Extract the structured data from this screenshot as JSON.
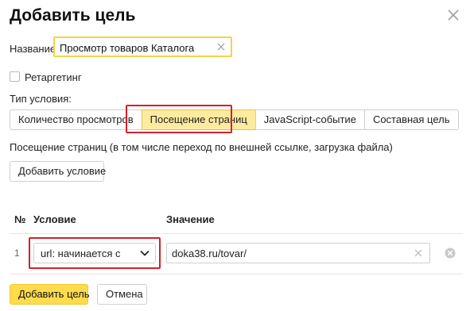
{
  "dialog": {
    "title": "Добавить цель",
    "close_icon": "close-icon"
  },
  "name_field": {
    "label": "Название",
    "value": "Просмотр товаров Каталога"
  },
  "retargeting": {
    "label": "Ретаргетинг",
    "checked": false
  },
  "condition_type": {
    "label": "Тип условия:",
    "tabs": [
      {
        "label": "Количество просмотров",
        "active": false
      },
      {
        "label": "Посещение страниц",
        "active": true
      },
      {
        "label": "JavaScript-событие",
        "active": false
      },
      {
        "label": "Составная цель",
        "active": false
      }
    ],
    "description": "Посещение страниц (в том числе переход по внешней ссылке, загрузка файла)"
  },
  "add_condition_label": "Добавить условие",
  "conditions_table": {
    "headers": {
      "num": "№",
      "condition": "Условие",
      "value": "Значение"
    },
    "rows": [
      {
        "num": "1",
        "condition": "url: начинается с",
        "value": "doka38.ru/tovar/"
      }
    ]
  },
  "footer": {
    "submit_label": "Добавить цель",
    "cancel_label": "Отмена"
  },
  "colors": {
    "accent_yellow": "#ffdb4d",
    "active_tab": "#ffeba0",
    "highlight_red": "#d4202b"
  }
}
